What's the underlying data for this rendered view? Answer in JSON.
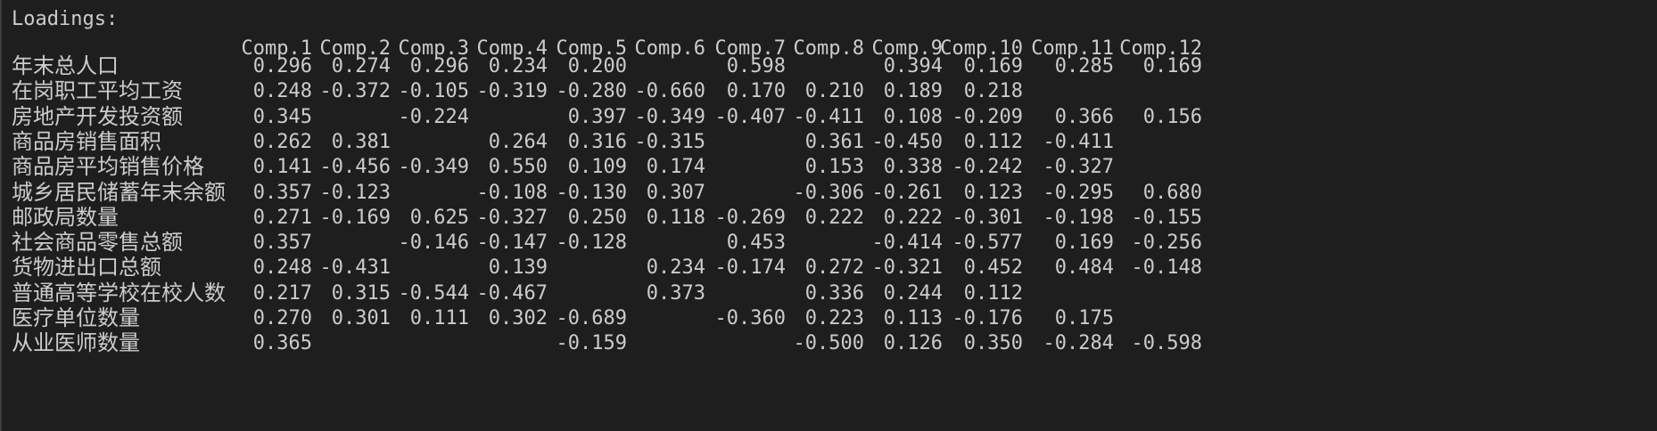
{
  "heading": "Loadings:",
  "columns": [
    "Comp.1",
    "Comp.2",
    "Comp.3",
    "Comp.4",
    "Comp.5",
    "Comp.6",
    "Comp.7",
    "Comp.8",
    "Comp.9",
    "Comp.10",
    "Comp.11",
    "Comp.12"
  ],
  "rows": [
    {
      "label": "年末总人口",
      "values": [
        "0.296",
        "0.274",
        "0.296",
        "0.234",
        "0.200",
        "",
        "0.598",
        "",
        "0.394",
        "0.169",
        "0.285",
        "0.169"
      ]
    },
    {
      "label": "在岗职工平均工资",
      "values": [
        "0.248",
        "-0.372",
        "-0.105",
        "-0.319",
        "-0.280",
        "-0.660",
        "0.170",
        "0.210",
        "0.189",
        "0.218",
        "",
        ""
      ]
    },
    {
      "label": "房地产开发投资额",
      "values": [
        "0.345",
        "",
        "-0.224",
        "",
        "0.397",
        "-0.349",
        "-0.407",
        "-0.411",
        "0.108",
        "-0.209",
        "0.366",
        "0.156"
      ]
    },
    {
      "label": "商品房销售面积",
      "values": [
        "0.262",
        "0.381",
        "",
        "0.264",
        "0.316",
        "-0.315",
        "",
        "0.361",
        "-0.450",
        "0.112",
        "-0.411",
        ""
      ]
    },
    {
      "label": "商品房平均销售价格",
      "values": [
        "0.141",
        "-0.456",
        "-0.349",
        "0.550",
        "0.109",
        "0.174",
        "",
        "0.153",
        "0.338",
        "-0.242",
        "-0.327",
        ""
      ]
    },
    {
      "label": "城乡居民储蓄年末余额",
      "values": [
        "0.357",
        "-0.123",
        "",
        "-0.108",
        "-0.130",
        "0.307",
        "",
        "-0.306",
        "-0.261",
        "0.123",
        "-0.295",
        "0.680"
      ]
    },
    {
      "label": "邮政局数量",
      "values": [
        "0.271",
        "-0.169",
        "0.625",
        "-0.327",
        "0.250",
        "0.118",
        "-0.269",
        "0.222",
        "0.222",
        "-0.301",
        "-0.198",
        "-0.155"
      ]
    },
    {
      "label": "社会商品零售总额",
      "values": [
        "0.357",
        "",
        "-0.146",
        "-0.147",
        "-0.128",
        "",
        "0.453",
        "",
        "-0.414",
        "-0.577",
        "0.169",
        "-0.256"
      ]
    },
    {
      "label": "货物进出口总额",
      "values": [
        "0.248",
        "-0.431",
        "",
        "0.139",
        "",
        "0.234",
        "-0.174",
        "0.272",
        "-0.321",
        "0.452",
        "0.484",
        "-0.148"
      ]
    },
    {
      "label": "普通高等学校在校人数",
      "values": [
        "0.217",
        "0.315",
        "-0.544",
        "-0.467",
        "",
        "0.373",
        "",
        "0.336",
        "0.244",
        "0.112",
        "",
        ""
      ]
    },
    {
      "label": "医疗单位数量",
      "values": [
        "0.270",
        "0.301",
        "0.111",
        "0.302",
        "-0.689",
        "",
        "-0.360",
        "0.223",
        "0.113",
        "-0.176",
        "0.175",
        ""
      ]
    },
    {
      "label": "从业医师数量",
      "values": [
        "0.365",
        "",
        "",
        "",
        "-0.159",
        "",
        "",
        "-0.500",
        "0.126",
        "0.350",
        "-0.284",
        "-0.598"
      ]
    }
  ],
  "colors": {
    "background": "#1e1e1e",
    "text": "#cccccc"
  }
}
